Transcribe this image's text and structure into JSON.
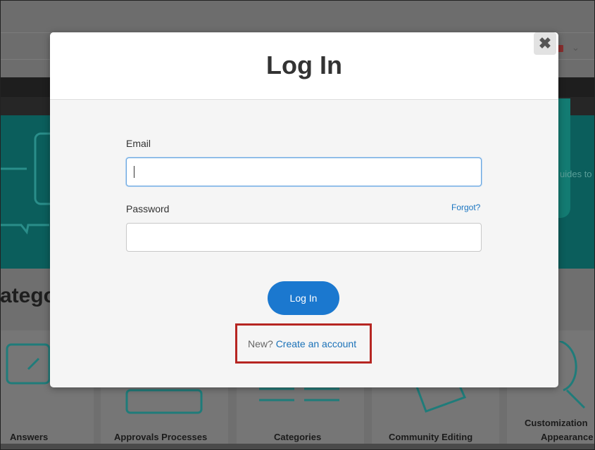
{
  "background": {
    "hero_text": "uides to",
    "section_title": "atego",
    "cards": [
      {
        "label": "Answers"
      },
      {
        "label": "Approvals Processes"
      },
      {
        "label": "Categories"
      },
      {
        "label": "Community Editing"
      },
      {
        "label": "Customization",
        "label2": "Appearance"
      }
    ]
  },
  "modal": {
    "title": "Log In",
    "close_glyph": "✖",
    "email_label": "Email",
    "email_value": "",
    "password_label": "Password",
    "password_value": "",
    "forgot_label": "Forgot?",
    "submit_label": "Log In",
    "new_prompt": "New?",
    "create_account_label": "Create an account"
  },
  "annotation": {
    "highlight_color": "#b62622"
  },
  "colors": {
    "primary_button": "#1b78cf",
    "link": "#1b72b8",
    "overlay_teal": "#0b5e5c"
  }
}
